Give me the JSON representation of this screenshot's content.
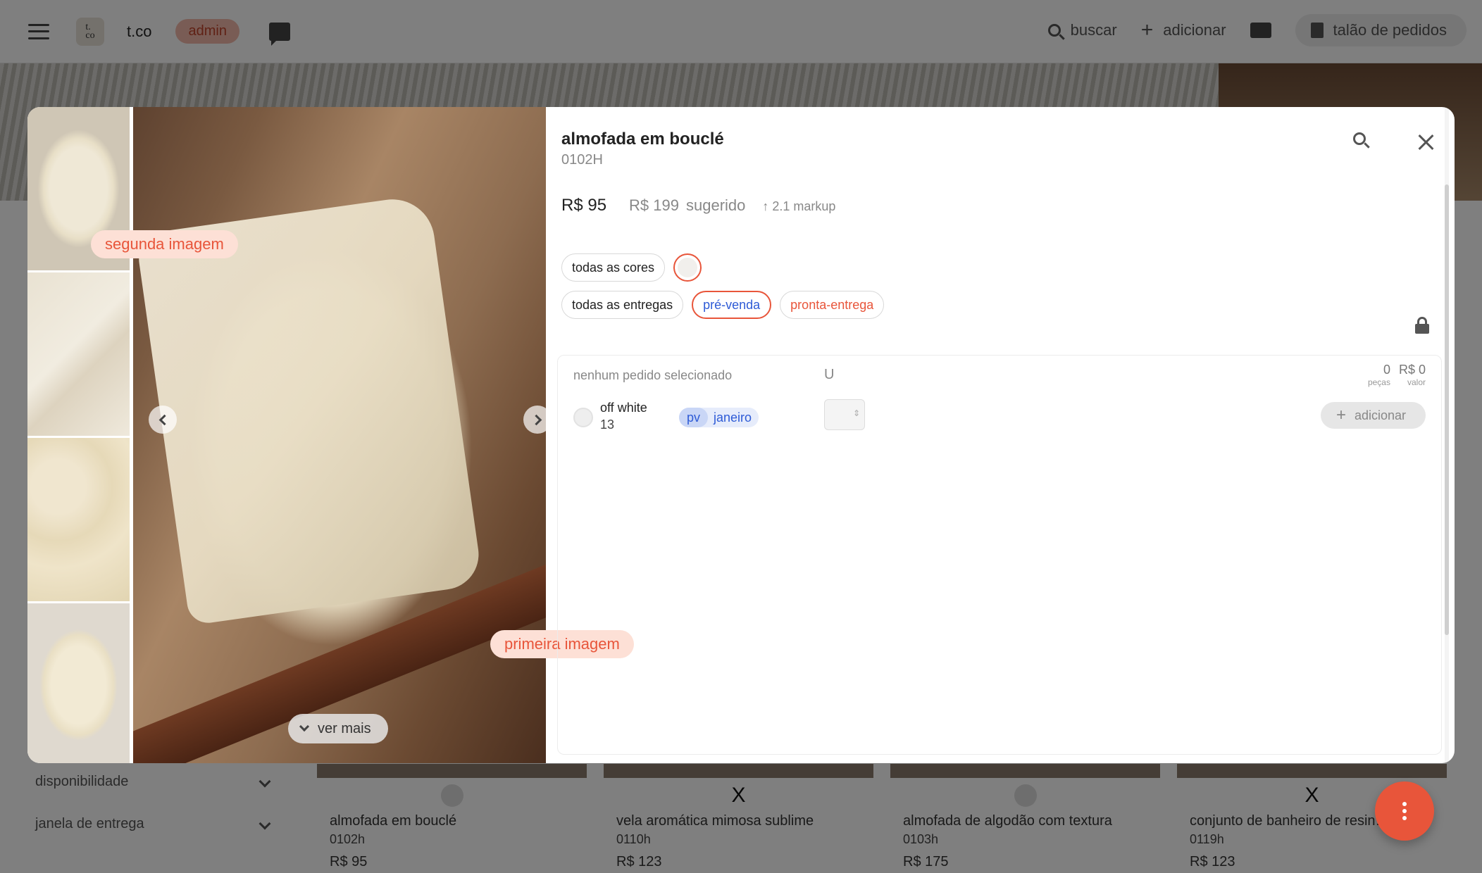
{
  "topbar": {
    "brand": "t.co",
    "logo_text": "t.\nco",
    "admin_label": "admin",
    "search_label": "buscar",
    "add_label": "adicionar",
    "orders_label": "talão de pedidos"
  },
  "sidebar_filters": [
    {
      "label": "disponibilidade"
    },
    {
      "label": "janela de entrega"
    }
  ],
  "product_cards": [
    {
      "marker": "",
      "name": "almofada em bouclé",
      "code": "0102h",
      "price": "R$ 95"
    },
    {
      "marker": "X",
      "name": "vela aromática mimosa sublime",
      "code": "0110h",
      "price": "R$ 123"
    },
    {
      "marker": "",
      "name": "almofada de algodão com textura",
      "code": "0103h",
      "price": "R$ 175"
    },
    {
      "marker": "X",
      "name": "conjunto de banheiro de resin…",
      "code": "0119h",
      "price": "R$ 123"
    }
  ],
  "modal": {
    "title": "almofada em bouclé",
    "sku": "0102H",
    "price": "R$ 95",
    "suggested_price": "R$ 199",
    "suggested_label": "sugerido",
    "markup": "↑ 2.1 markup",
    "color_filter_all": "todas as cores",
    "delivery_filter_all": "todas as entregas",
    "delivery_options": [
      "pré-venda",
      "pronta-entrega"
    ],
    "see_more": "ver mais",
    "tag_second_image": "segunda imagem",
    "tag_first_image": "primeira imagem",
    "order_panel": {
      "no_order": "nenhum pedido selecionado",
      "unit_header": "U",
      "pieces_value": "0",
      "pieces_label": "peças",
      "value_value": "R$ 0",
      "value_label": "valor",
      "variant": {
        "name": "off white",
        "stock": "13",
        "pv": "pv",
        "month": "janeiro"
      },
      "add_label": "adicionar"
    }
  },
  "colors": {
    "accent": "#e8553a",
    "blue": "#2e5bd6"
  }
}
